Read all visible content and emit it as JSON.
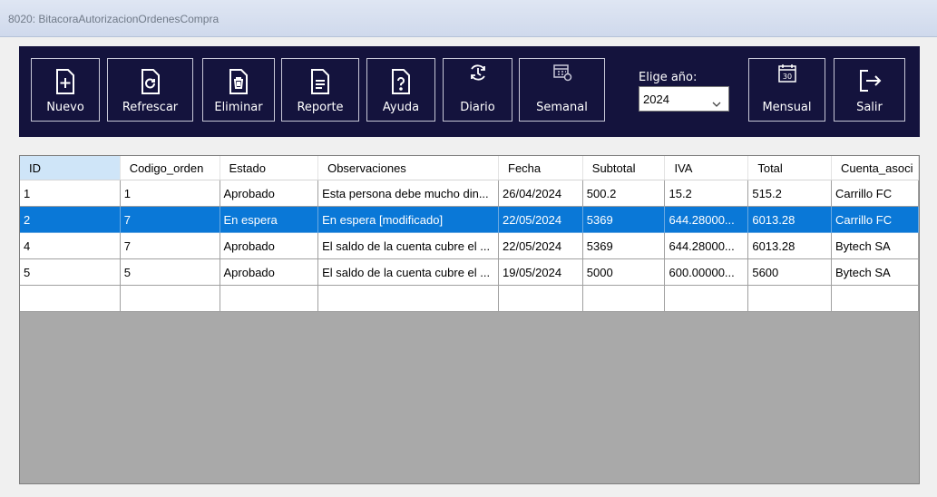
{
  "window": {
    "title": "8020: BitacoraAutorizacionOrdenesCompra"
  },
  "toolbar": {
    "buttons": [
      {
        "label": "Nuevo",
        "icon": "add-document-icon"
      },
      {
        "label": "Refrescar",
        "icon": "refresh-document-icon"
      },
      {
        "label": "Eliminar",
        "icon": "delete-document-icon"
      },
      {
        "label": "Reporte",
        "icon": "report-document-icon"
      },
      {
        "label": "Ayuda",
        "icon": "help-document-icon"
      },
      {
        "label": "Diario",
        "icon": "daily-cycle-icon"
      },
      {
        "label": "Semanal",
        "icon": "weekly-calendar-icon"
      },
      {
        "label": "Mensual",
        "icon": "monthly-calendar-icon"
      },
      {
        "label": "Salir",
        "icon": "exit-icon"
      }
    ],
    "year_label": "Elige año:",
    "year_value": "2024",
    "calendar_day": "30"
  },
  "table": {
    "columns": [
      "ID",
      "Codigo_orden",
      "Estado",
      "Observaciones",
      "Fecha",
      "Subtotal",
      "IVA",
      "Total",
      "Cuenta_asoci"
    ],
    "rows": [
      [
        "1",
        "1",
        "Aprobado",
        "Esta persona debe mucho din...",
        "26/04/2024",
        "500.2",
        "15.2",
        "515.2",
        "Carrillo FC"
      ],
      [
        "2",
        "7",
        "En espera",
        "En espera [modificado]",
        "22/05/2024",
        "5369",
        "644.28000...",
        "6013.28",
        "Carrillo FC"
      ],
      [
        "4",
        "7",
        "Aprobado",
        "El saldo de la cuenta cubre el ...",
        "22/05/2024",
        "5369",
        "644.28000...",
        "6013.28",
        "Bytech SA"
      ],
      [
        "5",
        "5",
        "Aprobado",
        "El saldo de la cuenta cubre el ...",
        "19/05/2024",
        "5000",
        "600.00000...",
        "5600",
        "Bytech SA"
      ],
      [
        "",
        "",
        "",
        "",
        "",
        "",
        "",
        "",
        ""
      ]
    ],
    "selected_row": 1
  },
  "colors": {
    "toolbar_bg": "#14133d",
    "selection": "#0a78d7",
    "empty_grid": "#a9a9a9"
  }
}
